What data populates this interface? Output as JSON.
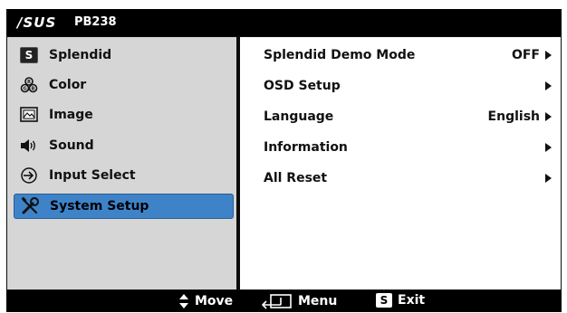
{
  "header": {
    "brand": "/SUS",
    "model": "PB238"
  },
  "menu": {
    "items": [
      {
        "label": "Splendid",
        "icon": "splendid-s-icon"
      },
      {
        "label": "Color",
        "icon": "color-palette-icon"
      },
      {
        "label": "Image",
        "icon": "image-icon"
      },
      {
        "label": "Sound",
        "icon": "speaker-icon"
      },
      {
        "label": "Input Select",
        "icon": "input-arrow-icon"
      },
      {
        "label": "System Setup",
        "icon": "tools-icon",
        "selected": true
      }
    ],
    "selected_color": "#3e83c8"
  },
  "options": [
    {
      "label": "Splendid Demo Mode",
      "value": "OFF"
    },
    {
      "label": "OSD Setup",
      "value": ""
    },
    {
      "label": "Language",
      "value": "English"
    },
    {
      "label": "Information",
      "value": ""
    },
    {
      "label": "All Reset",
      "value": ""
    }
  ],
  "footer": {
    "move_label": "Move",
    "menu_label": "Menu",
    "exit_label": "Exit",
    "exit_key": "S"
  }
}
